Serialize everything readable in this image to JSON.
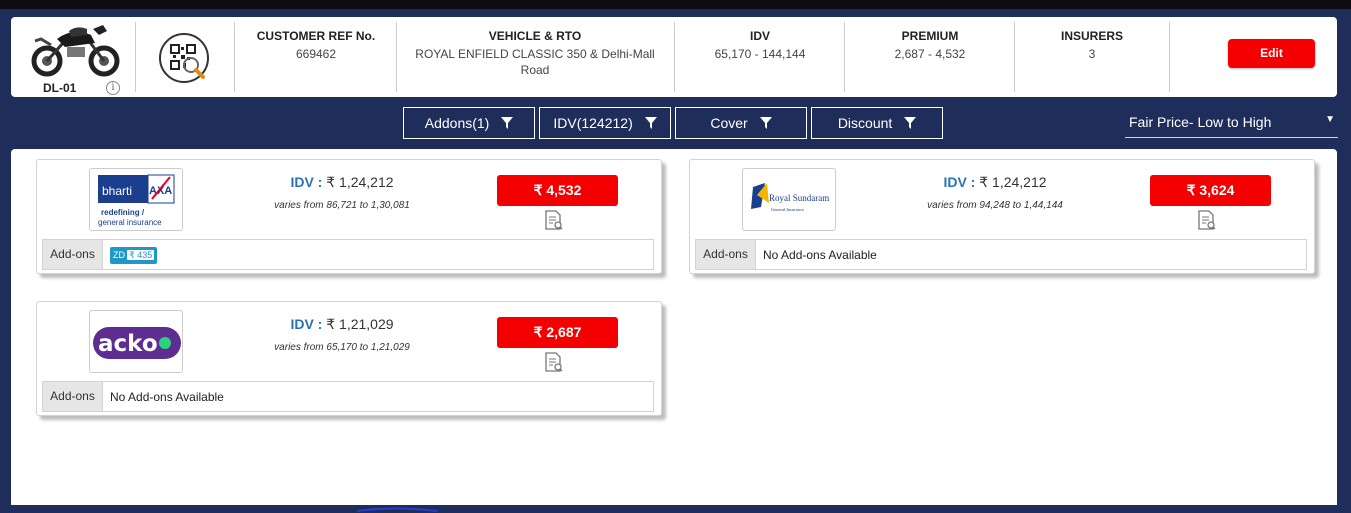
{
  "header": {
    "vehicle_code": "DL-01",
    "info_symbol": "i",
    "customer_ref": {
      "title": "CUSTOMER REF No.",
      "value": "669462"
    },
    "vehicle_rto": {
      "title": "VEHICLE & RTO",
      "value": "ROYAL ENFIELD CLASSIC 350 & Delhi-Mall Road"
    },
    "idv": {
      "title": "IDV",
      "value": "65,170 - 144,144"
    },
    "premium": {
      "title": "PREMIUM",
      "value": "2,687 - 4,532"
    },
    "insurers": {
      "title": "INSURERS",
      "value": "3"
    },
    "edit_label": "Edit"
  },
  "filters": [
    {
      "label": "Addons(1)",
      "icon": "filter-icon"
    },
    {
      "label": "IDV(124212)",
      "icon": "filter-icon"
    },
    {
      "label": "Cover",
      "icon": "filter-icon"
    },
    {
      "label": "Discount",
      "icon": "filter-icon"
    }
  ],
  "sort": {
    "selected": "Fair Price- Low to High",
    "arrow": "▼"
  },
  "cards": [
    {
      "insurer_logo": "bharti-axa-logo",
      "logo_text": {
        "brand": "bharti",
        "tag1": "redefining /",
        "tag2": "general insurance",
        "axa": "AXA"
      },
      "idv_label": "IDV :",
      "idv_value": "₹ 1,24,212",
      "varies": "varies from 86,721 to 1,30,081",
      "price": "₹ 4,532",
      "addons_label": "Add-ons",
      "addon_badge": {
        "code": "ZD",
        "amount": "₹ 435"
      }
    },
    {
      "insurer_logo": "royal-sundaram-logo",
      "logo_text": {
        "brand": "Royal Sundaram",
        "tag": "General Insurance"
      },
      "idv_label": "IDV :",
      "idv_value": "₹ 1,24,212",
      "varies": "varies from 94,248 to 1,44,144",
      "price": "₹ 3,624",
      "addons_label": "Add-ons",
      "addons_text": "No Add-ons Available"
    },
    {
      "insurer_logo": "acko-logo",
      "logo_text": {
        "brand": "acko"
      },
      "idv_label": "IDV :",
      "idv_value": "₹ 1,21,029",
      "varies": "varies from 65,170 to 1,21,029",
      "price": "₹ 2,687",
      "addons_label": "Add-ons",
      "addons_text": "No Add-ons Available"
    }
  ],
  "colors": {
    "page_bg": "#1f2d5b",
    "accent_red": "#f40000",
    "idv_blue": "#2a72b5",
    "addon_badge": "#2196c9"
  }
}
